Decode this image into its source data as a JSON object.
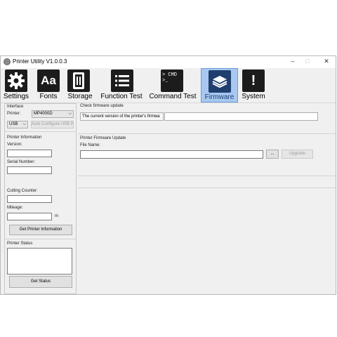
{
  "window": {
    "title": "Printer Utility  V1.0.0.3",
    "minimize": "–",
    "maximize": "□",
    "close": "✕"
  },
  "toolbar": {
    "items": [
      {
        "label": "Settings",
        "icon": "gear-icon"
      },
      {
        "label": "Fonts",
        "icon": "font-icon",
        "glyph": "Aa"
      },
      {
        "label": "Storage",
        "icon": "storage-icon"
      },
      {
        "label": "Function Test",
        "icon": "list-icon"
      },
      {
        "label": "Command Test",
        "icon": "terminal-icon",
        "glyph": "> CMD\n>_"
      },
      {
        "label": "Firmware",
        "icon": "firmware-chip-icon"
      },
      {
        "label": "System",
        "icon": "alert-icon",
        "glyph": "!"
      }
    ],
    "selected": "Firmware"
  },
  "interface": {
    "header": "Interface",
    "printer_label": "Printer:",
    "printer_value": "MP4000D",
    "port_value": "USB",
    "auto_configure": "Auto Configure USB Po"
  },
  "printer_info": {
    "header": "Printer Information",
    "version_label": "Version:",
    "serial_label": "Serial Number:",
    "cutting_label": "Cutting Counter:",
    "mileage_label": "Mileage:",
    "mileage_unit": "m",
    "get_info_button": "Get Printer Information"
  },
  "printer_status": {
    "header": "Printer Status",
    "get_status_button": "Get Status"
  },
  "check_update": {
    "header": "Check firmware update",
    "current_version_text": "The current version of the printer's firmwa"
  },
  "firmware_update": {
    "header": "Printer Firmware Update",
    "file_name_label": "File Name:",
    "browse_button": "...",
    "upgrade_button": "Upgrade"
  }
}
